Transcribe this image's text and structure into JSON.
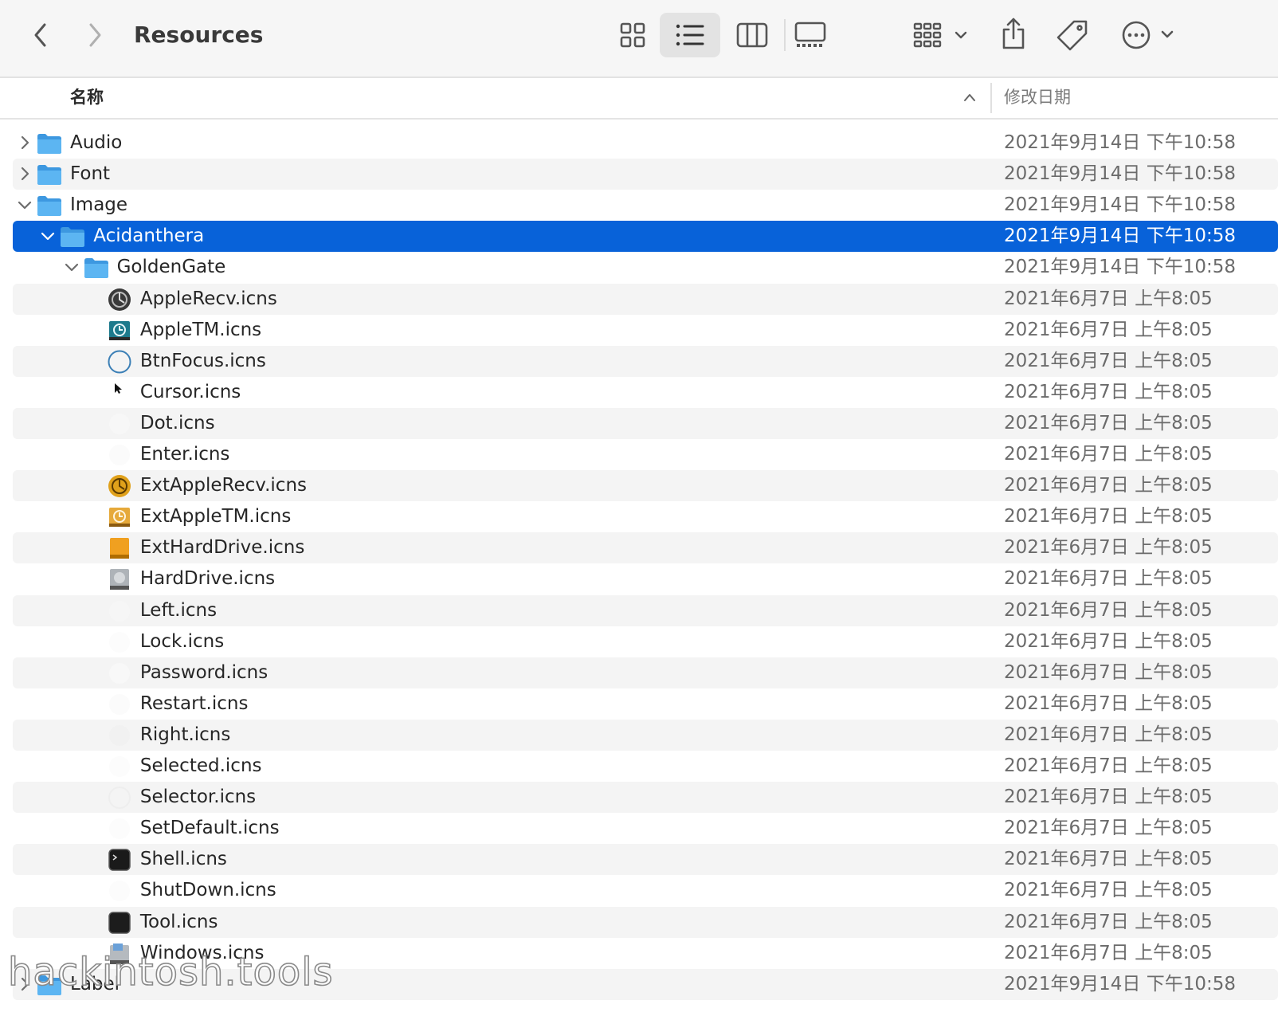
{
  "window": {
    "title": "Resources"
  },
  "toolbar": {
    "back_icon": "chevron-left-icon",
    "forward_icon": "chevron-right-icon",
    "views": [
      "icon-view",
      "list-view",
      "column-view",
      "gallery-view"
    ],
    "active_view": "list-view",
    "group_icon": "group-grid-icon",
    "share_icon": "share-icon",
    "tag_icon": "tag-icon",
    "more_icon": "ellipsis-circle-icon"
  },
  "columns": {
    "name": "名称",
    "modified": "修改日期",
    "sort": "ascending"
  },
  "colors": {
    "selection": "#0862d9",
    "folder": "#4aa8ee",
    "stripe": "#f4f4f4"
  },
  "rows": [
    {
      "name": "Audio",
      "date": "2021年9月14日 下午10:58",
      "kind": "folder",
      "level": 0,
      "disclosure": "collapsed"
    },
    {
      "name": "Font",
      "date": "2021年9月14日 下午10:58",
      "kind": "folder",
      "level": 0,
      "disclosure": "collapsed"
    },
    {
      "name": "Image",
      "date": "2021年9月14日 下午10:58",
      "kind": "folder",
      "level": 0,
      "disclosure": "expanded"
    },
    {
      "name": "Acidanthera",
      "date": "2021年9月14日 下午10:58",
      "kind": "folder",
      "level": 1,
      "disclosure": "expanded",
      "selected": true
    },
    {
      "name": "GoldenGate",
      "date": "2021年9月14日 下午10:58",
      "kind": "folder",
      "level": 2,
      "disclosure": "expanded"
    },
    {
      "name": "AppleRecv.icns",
      "date": "2021年6月7日 上午8:05",
      "kind": "icns",
      "icon": "recovery-dark-icon",
      "level": 3
    },
    {
      "name": "AppleTM.icns",
      "date": "2021年6月7日 上午8:05",
      "kind": "icns",
      "icon": "time-machine-icon",
      "level": 3
    },
    {
      "name": "BtnFocus.icns",
      "date": "2021年6月7日 上午8:05",
      "kind": "icns",
      "icon": "focus-ring-icon",
      "level": 3
    },
    {
      "name": "Cursor.icns",
      "date": "2021年6月7日 上午8:05",
      "kind": "icns",
      "icon": "cursor-icon",
      "level": 3
    },
    {
      "name": "Dot.icns",
      "date": "2021年6月7日 上午8:05",
      "kind": "icns",
      "icon": "dot-icon",
      "level": 3
    },
    {
      "name": "Enter.icns",
      "date": "2021年6月7日 上午8:05",
      "kind": "icns",
      "icon": "enter-icon",
      "level": 3
    },
    {
      "name": "ExtAppleRecv.icns",
      "date": "2021年6月7日 上午8:05",
      "kind": "icns",
      "icon": "recovery-external-icon",
      "level": 3
    },
    {
      "name": "ExtAppleTM.icns",
      "date": "2021年6月7日 上午8:05",
      "kind": "icns",
      "icon": "time-machine-external-icon",
      "level": 3
    },
    {
      "name": "ExtHardDrive.icns",
      "date": "2021年6月7日 上午8:05",
      "kind": "icns",
      "icon": "external-drive-icon",
      "level": 3
    },
    {
      "name": "HardDrive.icns",
      "date": "2021年6月7日 上午8:05",
      "kind": "icns",
      "icon": "hard-drive-icon",
      "level": 3
    },
    {
      "name": "Left.icns",
      "date": "2021年6月7日 上午8:05",
      "kind": "icns",
      "icon": "left-icon",
      "level": 3
    },
    {
      "name": "Lock.icns",
      "date": "2021年6月7日 上午8:05",
      "kind": "icns",
      "icon": "lock-icon",
      "level": 3
    },
    {
      "name": "Password.icns",
      "date": "2021年6月7日 上午8:05",
      "kind": "icns",
      "icon": "password-icon",
      "level": 3
    },
    {
      "name": "Restart.icns",
      "date": "2021年6月7日 上午8:05",
      "kind": "icns",
      "icon": "restart-icon",
      "level": 3
    },
    {
      "name": "Right.icns",
      "date": "2021年6月7日 上午8:05",
      "kind": "icns",
      "icon": "right-icon",
      "level": 3
    },
    {
      "name": "Selected.icns",
      "date": "2021年6月7日 上午8:05",
      "kind": "icns",
      "icon": "selected-icon",
      "level": 3
    },
    {
      "name": "Selector.icns",
      "date": "2021年6月7日 上午8:05",
      "kind": "icns",
      "icon": "selector-icon",
      "level": 3
    },
    {
      "name": "SetDefault.icns",
      "date": "2021年6月7日 上午8:05",
      "kind": "icns",
      "icon": "set-default-icon",
      "level": 3
    },
    {
      "name": "Shell.icns",
      "date": "2021年6月7日 上午8:05",
      "kind": "icns",
      "icon": "shell-icon",
      "level": 3
    },
    {
      "name": "ShutDown.icns",
      "date": "2021年6月7日 上午8:05",
      "kind": "icns",
      "icon": "shutdown-icon",
      "level": 3
    },
    {
      "name": "Tool.icns",
      "date": "2021年6月7日 上午8:05",
      "kind": "icns",
      "icon": "tool-icon",
      "level": 3
    },
    {
      "name": "Windows.icns",
      "date": "2021年6月7日 上午8:05",
      "kind": "icns",
      "icon": "windows-drive-icon",
      "level": 3
    },
    {
      "name": "Label",
      "date": "2021年9月14日 下午10:58",
      "kind": "folder",
      "level": 0,
      "disclosure": "collapsed"
    }
  ],
  "watermark": "hackintosh.tools"
}
